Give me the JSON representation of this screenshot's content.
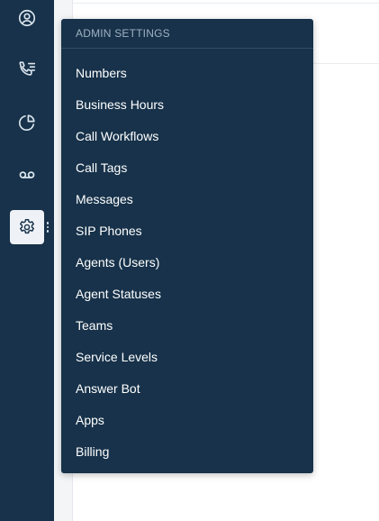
{
  "sidebar": {
    "icons": [
      {
        "name": "user-circle-icon"
      },
      {
        "name": "phone-list-icon"
      },
      {
        "name": "pie-chart-icon"
      },
      {
        "name": "voicemail-icon"
      },
      {
        "name": "gear-icon",
        "active": true
      }
    ]
  },
  "menu": {
    "header": "ADMIN SETTINGS",
    "items": [
      {
        "label": "Numbers"
      },
      {
        "label": "Business Hours"
      },
      {
        "label": "Call Workflows"
      },
      {
        "label": "Call Tags"
      },
      {
        "label": "Messages"
      },
      {
        "label": "SIP Phones"
      },
      {
        "label": "Agents (Users)"
      },
      {
        "label": "Agent Statuses"
      },
      {
        "label": "Teams"
      },
      {
        "label": "Service Levels"
      },
      {
        "label": "Answer Bot"
      },
      {
        "label": "Apps"
      },
      {
        "label": "Billing"
      }
    ]
  },
  "colors": {
    "sidebar_bg": "#17324a",
    "menu_bg": "#17324a",
    "icon_stroke": "#dce6ee",
    "active_bg": "#eef2f6",
    "menu_text": "#ffffff",
    "header_text": "#9fb1c1"
  }
}
